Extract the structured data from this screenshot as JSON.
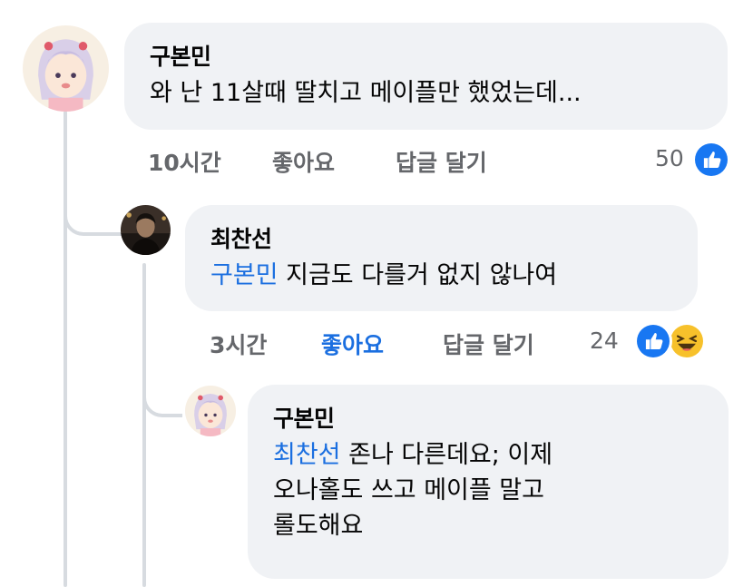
{
  "comments": [
    {
      "author": "구본민",
      "text": "와 난 11살때 딸치고 메이플만 했었는데...",
      "time": "10시간",
      "like_label": "좋아요",
      "reply_label": "답글 달기",
      "reaction_count": "50",
      "reactions": [
        "like-icon"
      ]
    },
    {
      "author": "최찬선",
      "mention": "구본민",
      "text": "지금도 다를거 없지 않나여",
      "time": "3시간",
      "like_label": "좋아요",
      "liked": true,
      "reply_label": "답글 달기",
      "reaction_count": "24",
      "reactions": [
        "like-icon",
        "haha-icon"
      ]
    },
    {
      "author": "구본민",
      "mention": "최찬선",
      "text_line1": "존나 다른데요; 이제",
      "text_line2": "오나홀도 쓰고 메이플 말고",
      "text_line3": "롤도해요"
    }
  ],
  "colors": {
    "bubble": "#f0f2f5",
    "accent": "#1b6fe0",
    "meta": "#65676b",
    "thread_line": "#d7dbe0"
  }
}
